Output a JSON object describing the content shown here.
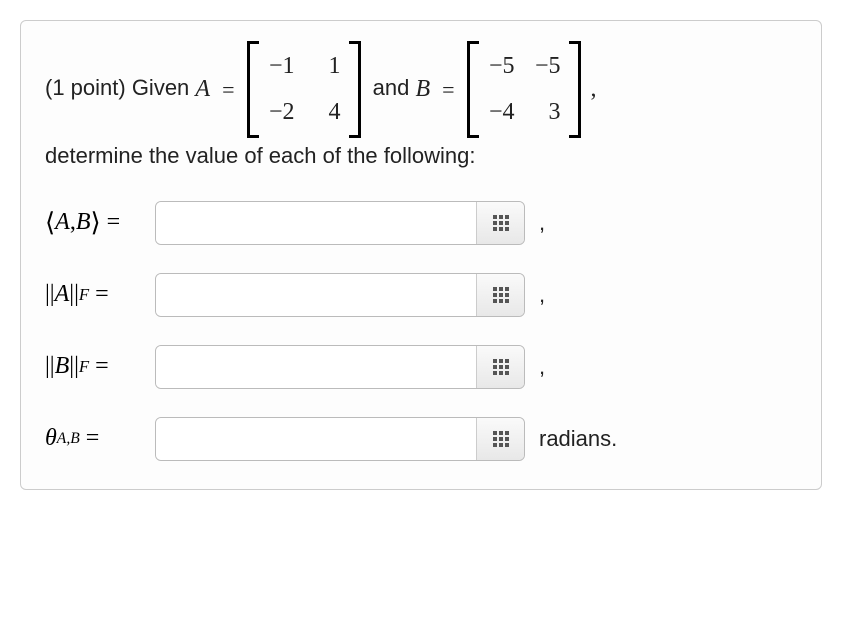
{
  "question": {
    "points_prefix": "(1 point) Given ",
    "given_A_label": "A",
    "between_text": " and ",
    "given_B_label": "B",
    "trailing_comma": ",",
    "followup": "determine the value of each of the following:"
  },
  "matrixA": {
    "r1c1": "−1",
    "r1c2": "1",
    "r2c1": "−2",
    "r2c2": "4"
  },
  "matrixB": {
    "r1c1": "−5",
    "r1c2": "−5",
    "r2c1": "−4",
    "r2c2": "3"
  },
  "rows": {
    "inner_product": {
      "left_bracket": "⟨",
      "A": "A",
      "comma": ", ",
      "B": "B",
      "right_bracket": "⟩",
      "equals": "=",
      "trailing": ","
    },
    "normA": {
      "bars_open": "||",
      "A": "A",
      "bars_close": "||",
      "sub": "F",
      "equals": "=",
      "trailing": ","
    },
    "normB": {
      "bars_open": "||",
      "B": "B",
      "bars_close": "||",
      "sub": "F",
      "equals": "=",
      "trailing": ","
    },
    "theta": {
      "symbol": "θ",
      "sub": "A,B",
      "equals": "=",
      "trailing": "radians."
    }
  }
}
